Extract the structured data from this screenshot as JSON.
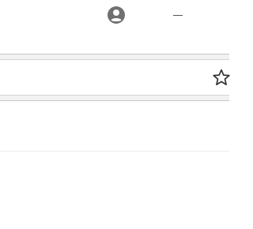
{
  "titlebar": {
    "profile_icon": "account-circle-icon",
    "minimize_icon": "minimize-icon"
  },
  "toolbar": {
    "address_value": "",
    "star_icon": "star-outline-icon"
  },
  "colors": {
    "icon_gray": "#707070",
    "border": "#c7c7c7",
    "band": "#f2f2f2",
    "background": "#ffffff"
  }
}
